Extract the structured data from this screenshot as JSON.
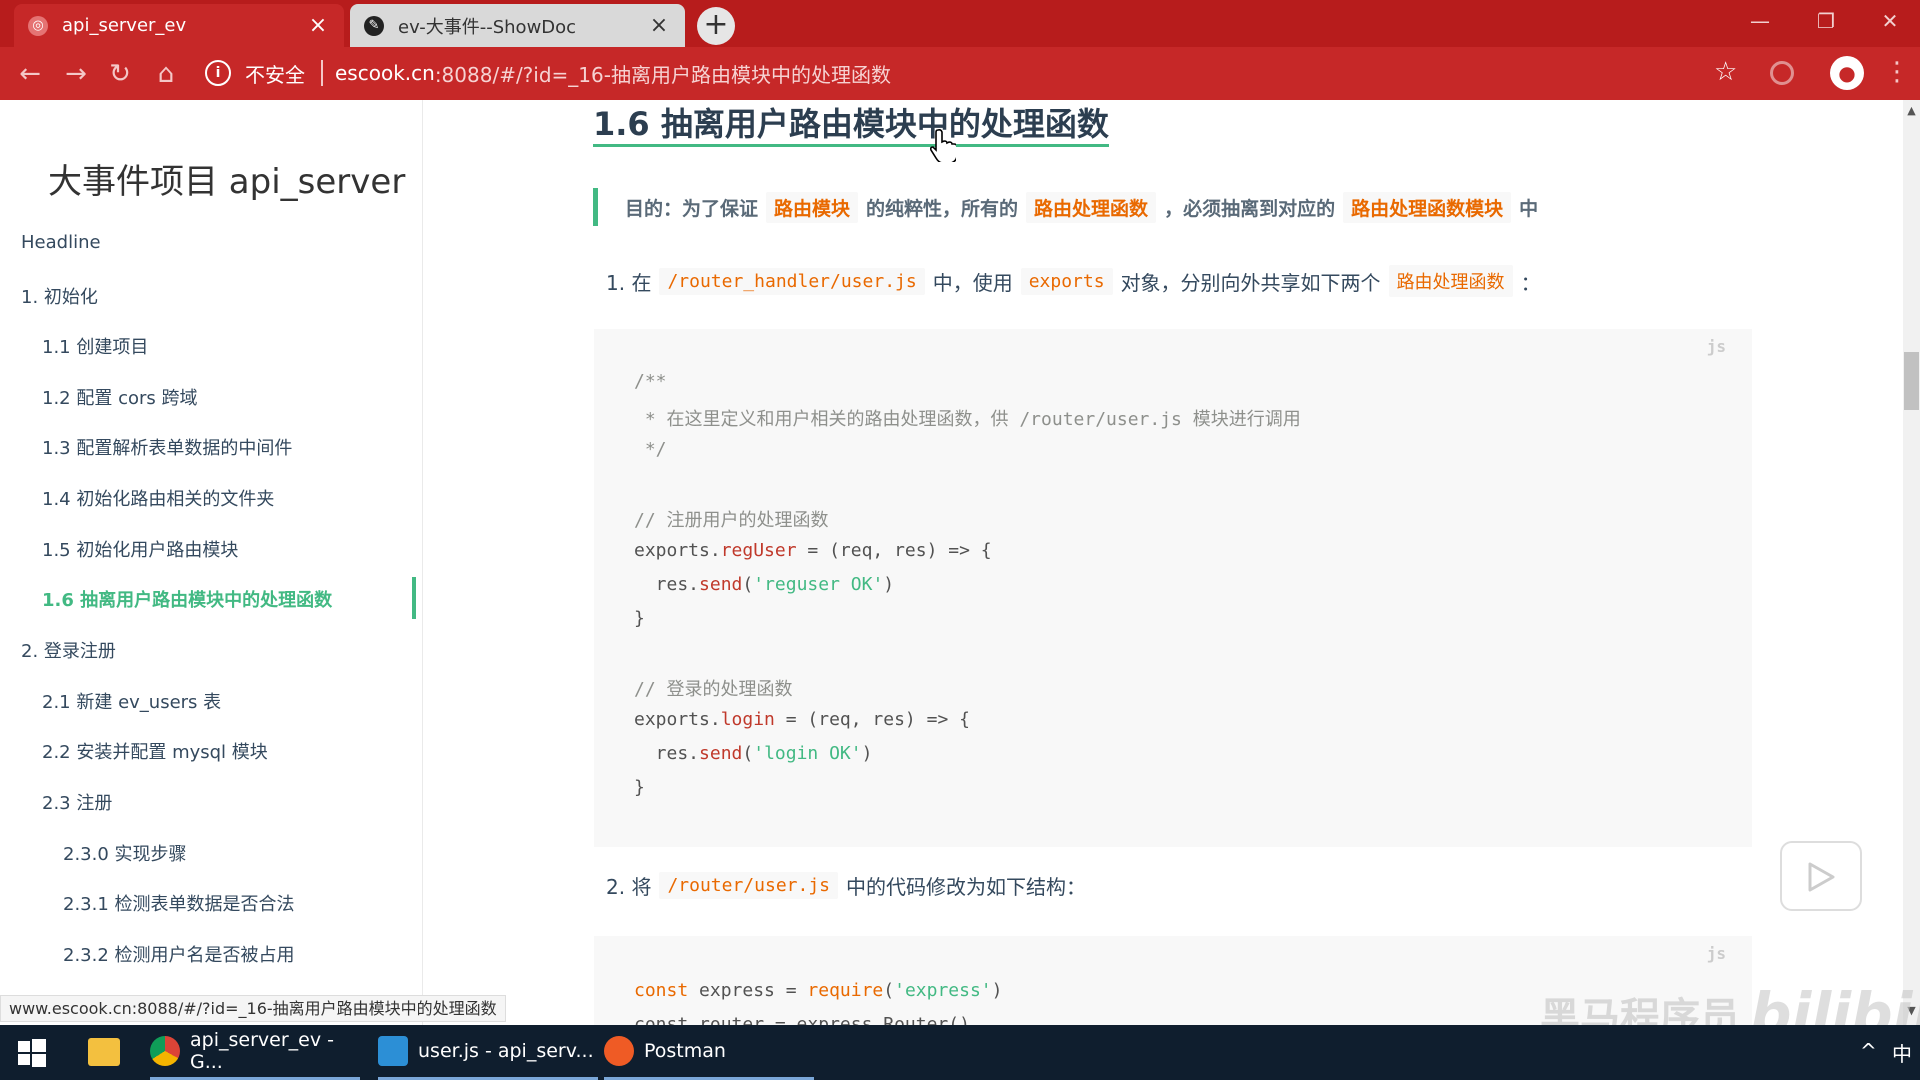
{
  "browser": {
    "tabs": [
      {
        "title": "api_server_ev",
        "icon": "globe-icon",
        "active": true
      },
      {
        "title": "ev-大事件--ShowDoc",
        "icon": "showdoc-icon",
        "active": false
      }
    ],
    "new_tab": "+",
    "address": {
      "security_label": "不安全",
      "host": "escook.cn",
      "path": ":8088/#/?id=_16-抽离用户路由模块中的处理函数"
    },
    "window_controls": {
      "minimize": "—",
      "restore": "❐",
      "close": "✕"
    },
    "nav": {
      "back": "←",
      "forward": "→",
      "reload": "↻",
      "home": "⌂"
    },
    "star": "☆",
    "menu": "⋮"
  },
  "sidebar": {
    "site_title": "大事件项目 api_server",
    "items": [
      {
        "label": "Headline",
        "level": 1
      },
      {
        "label": "1. 初始化",
        "level": 1
      },
      {
        "label": "1.1 创建项目",
        "level": 2
      },
      {
        "label": "1.2 配置 cors 跨域",
        "level": 2
      },
      {
        "label": "1.3 配置解析表单数据的中间件",
        "level": 2
      },
      {
        "label": "1.4 初始化路由相关的文件夹",
        "level": 2
      },
      {
        "label": "1.5 初始化用户路由模块",
        "level": 2
      },
      {
        "label": "1.6 抽离用户路由模块中的处理函数",
        "level": 2,
        "active": true
      },
      {
        "label": "2. 登录注册",
        "level": 1
      },
      {
        "label": "2.1 新建 ev_users 表",
        "level": 2
      },
      {
        "label": "2.2 安装并配置 mysql 模块",
        "level": 2
      },
      {
        "label": "2.3 注册",
        "level": 2
      },
      {
        "label": "2.3.0 实现步骤",
        "level": 3
      },
      {
        "label": "2.3.1 检测表单数据是否合法",
        "level": 3
      },
      {
        "label": "2.3.2 检测用户名是否被占用",
        "level": 3
      }
    ]
  },
  "content": {
    "heading": "1.6 抽离用户路由模块中的处理函数",
    "tip": {
      "t1": "目的：为了保证",
      "h1": "路由模块",
      "t2": "的纯粹性，所有的",
      "h2": "路由处理函数",
      "t3": "，必须抽离到对应的",
      "h3": "路由处理函数模块",
      "t4": "中"
    },
    "step1": {
      "t1": "1. 在",
      "c1": "/router_handler/user.js",
      "t2": "中，使用",
      "c2": "exports",
      "t3": "对象，分别向外共享如下两个",
      "c3": "路由处理函数",
      "t4": "："
    },
    "code1": {
      "lang": "js",
      "lines": {
        "l1": "/**",
        "l2": " * 在这里定义和用户相关的路由处理函数，供 /router/user.js 模块进行调用",
        "l3": " */",
        "l5": "// 注册用户的处理函数",
        "l6a": "exports.",
        "l6b": "regUser",
        "l6c": " = (req, res) => {",
        "l7a": "  res.",
        "l7b": "send",
        "l7c": "(",
        "l7d": "'reguser OK'",
        "l7e": ")",
        "l8": "}",
        "l10": "// 登录的处理函数",
        "l11a": "exports.",
        "l11b": "login",
        "l11c": " = (req, res) => {",
        "l12a": "  res.",
        "l12b": "send",
        "l12c": "(",
        "l12d": "'login OK'",
        "l12e": ")",
        "l13": "}"
      }
    },
    "step2": {
      "t1": "2. 将",
      "c1": "/router/user.js",
      "t2": "中的代码修改为如下结构："
    },
    "code2": {
      "lang": "js",
      "lines": {
        "l1a": "const",
        "l1b": " express = ",
        "l1c": "require",
        "l1d": "(",
        "l1e": "'express'",
        "l1f": ")",
        "l2": "const router = express.Router()"
      }
    }
  },
  "status_url": "www.escook.cn:8088/#/?id=_16-抽离用户路由模块中的处理函数",
  "watermark": {
    "text": "黑马程序员",
    "logo": "bilibili"
  },
  "taskbar": {
    "items": [
      {
        "label": "api_server_ev - G...",
        "icon": "chrome-icon"
      },
      {
        "label": "user.js - api_serv...",
        "icon": "vscode-icon"
      },
      {
        "label": "Postman",
        "icon": "postman-icon"
      }
    ],
    "tray_ime": "中",
    "tray_up": "^"
  },
  "colors": {
    "accent": "#42b983",
    "inline_code": "#e96900",
    "chrome_bar": "#c62828",
    "taskbar": "#0f1e2e"
  }
}
